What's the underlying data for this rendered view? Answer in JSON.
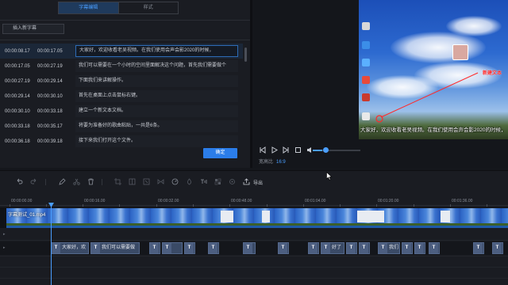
{
  "editor": {
    "tabs": [
      "字幕编辑",
      "样式"
    ],
    "insert_button": "插入新字幕",
    "rows": [
      {
        "start": "00:00:08.17",
        "end": "00:00:17.05",
        "text": "大家好，欢迎收看老吴视频。在我们使用会声会影2020的时候，"
      },
      {
        "start": "00:00:17.05",
        "end": "00:00:27.19",
        "text": "我们可以需要在一个小时的空间里面解决这个问题，首先我们需要做个"
      },
      {
        "start": "00:00:27.19",
        "end": "00:00:29.14",
        "text": "下面我们来讲解操作。"
      },
      {
        "start": "00:00:29.14",
        "end": "00:00:30.10",
        "text": "首先在桌面上点击鼠标右键。"
      },
      {
        "start": "00:00:30.10",
        "end": "00:00:33.18",
        "text": "建立一个新文本文档。"
      },
      {
        "start": "00:00:33.18",
        "end": "00:00:35.17",
        "text": "将要为准备好的歌曲粘贴，一共是6条。"
      },
      {
        "start": "00:00:36.18",
        "end": "00:00:39.18",
        "text": "接下来我们打开这个文件。"
      }
    ],
    "confirm_button": "确定"
  },
  "preview": {
    "caption": "大家好，欢迎收看老吴视频。在我们使用会声会影2020的时候，",
    "red_label": "新建文本",
    "ratio_label": "宽高比",
    "ratio_value": "16:9",
    "progress": 0.2
  },
  "timeline": {
    "export_label": "导出",
    "clip_name": "字幕测试_01.mp4",
    "ruler_labels": [
      "00:00:00.00",
      "00:00:16.00",
      "00:00:32.00",
      "00:00:48.00",
      "00:01:04.00",
      "00:01:20.00",
      "00:01:36.00"
    ],
    "subtitle_blocks": [
      {
        "label": "大家好，欢"
      },
      {
        "label": "我们可以需要做"
      },
      {
        "label": ""
      },
      {
        "label": ""
      },
      {
        "label": ""
      },
      {
        "label": ""
      },
      {
        "label": ""
      },
      {
        "label": ""
      },
      {
        "label": ""
      },
      {
        "label": "好了"
      },
      {
        "label": ""
      },
      {
        "label": ""
      },
      {
        "label": "我们"
      },
      {
        "label": ""
      },
      {
        "label": ""
      },
      {
        "label": ""
      },
      {
        "label": ""
      }
    ]
  },
  "colors": {
    "accent": "#4a9eff",
    "confirm": "#2b7de9",
    "background": "#15171c"
  }
}
